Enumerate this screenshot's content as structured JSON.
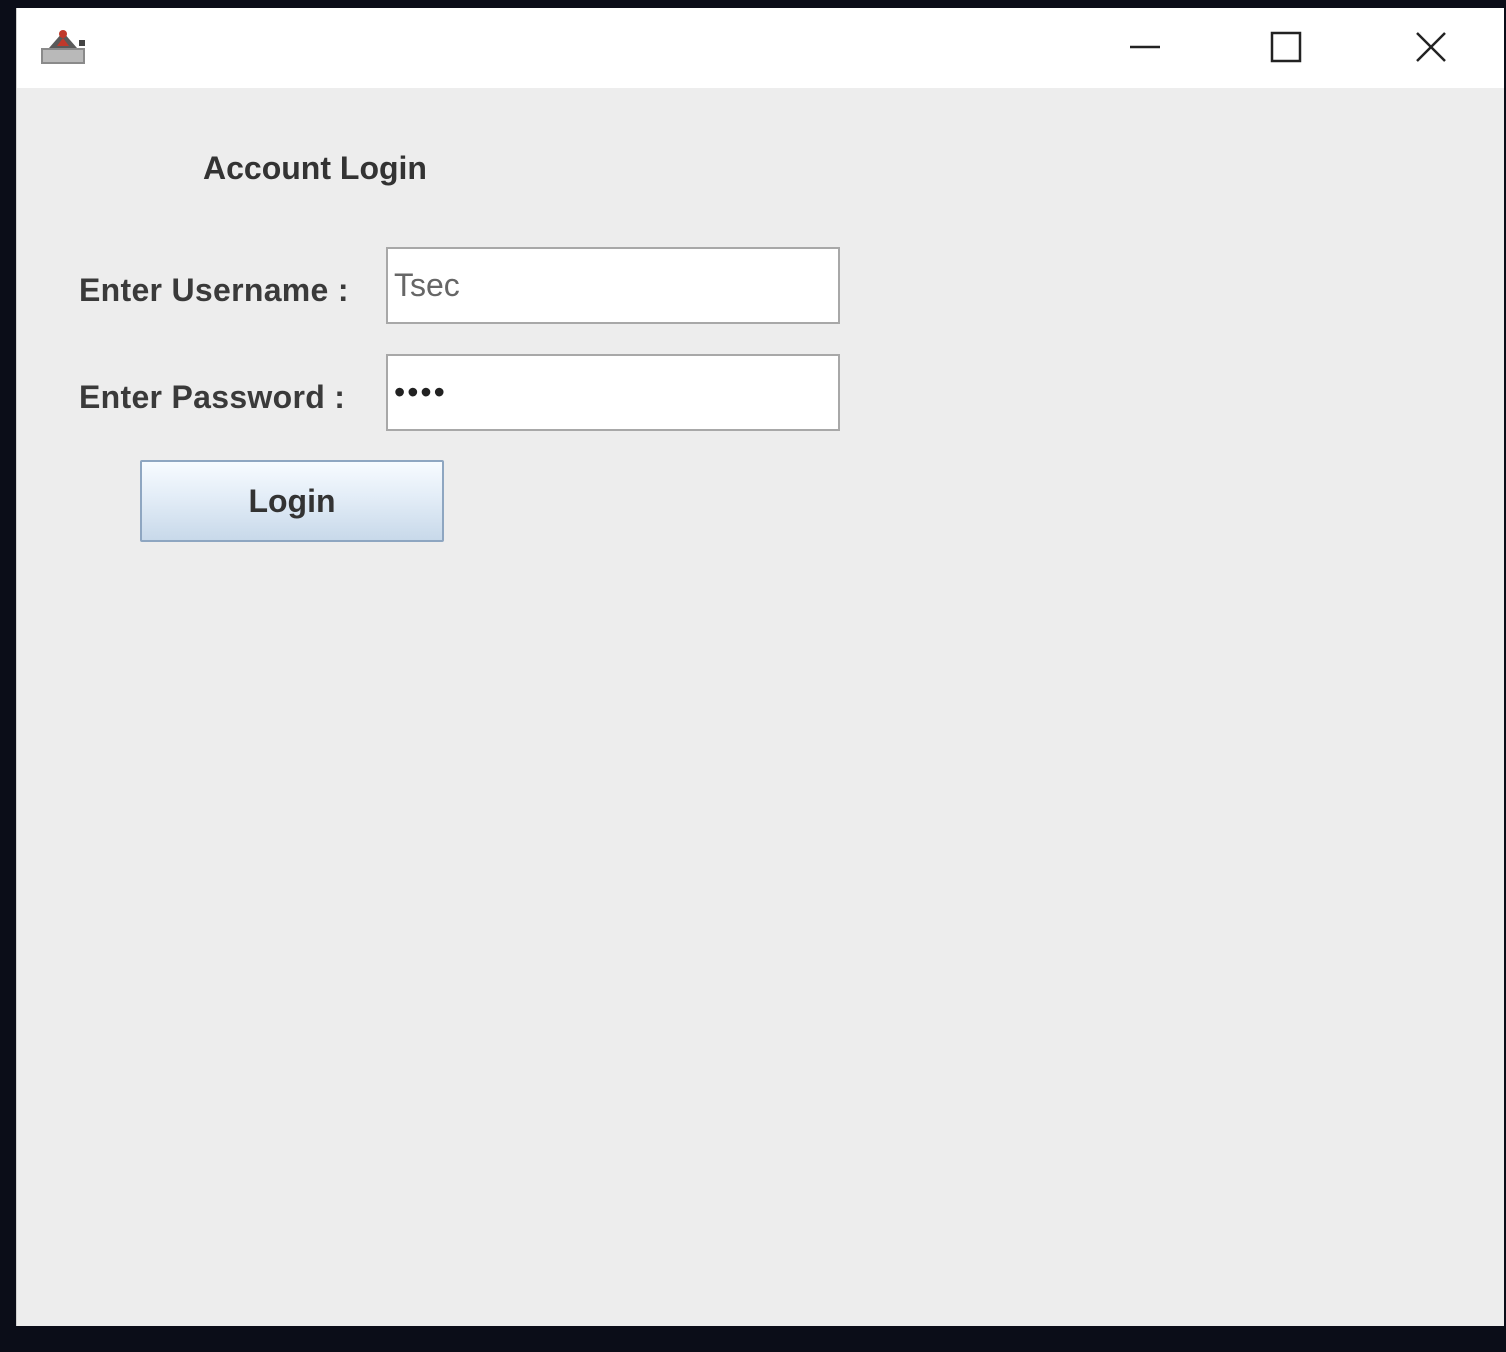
{
  "window": {
    "icons": {
      "app": "java-app-icon",
      "minimize": "minimize-icon",
      "maximize": "maximize-icon",
      "close": "close-icon"
    }
  },
  "form": {
    "heading": "Account Login",
    "username_label": "Enter Username :",
    "username_value": "Tsec",
    "password_label": "Enter Password :",
    "password_value": "••••",
    "login_label": "Login"
  },
  "colors": {
    "window_background": "#ededed",
    "titlebar_background": "#ffffff",
    "button_border": "#8ea6c1",
    "desktop_background": "#0b0d18"
  }
}
